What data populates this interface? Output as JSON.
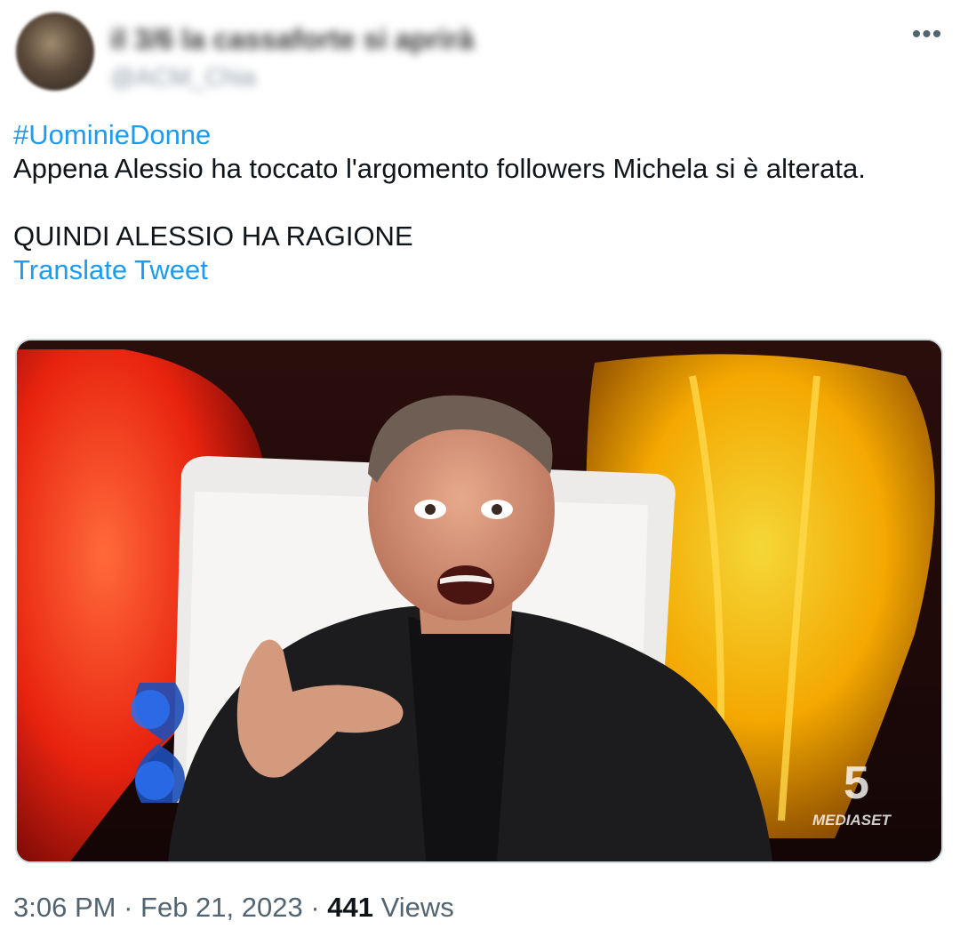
{
  "author": {
    "display_name": "il 3/6 la cassaforte si aprirà",
    "handle": "@ACM_Chia"
  },
  "tweet": {
    "hashtag": "#UominieDonne",
    "line1": "Appena Alessio ha toccato l'argomento followers Michela si è alterata.",
    "line2": "QUINDI ALESSIO HA RAGIONE",
    "translate_label": "Translate Tweet",
    "media_watermark_number": "5",
    "media_watermark_text": "MEDIASET"
  },
  "meta": {
    "time": "3:06 PM",
    "sep1": " · ",
    "date": "Feb 21, 2023",
    "sep2": " · ",
    "views_count": "441",
    "views_label": " Views"
  },
  "icons": {
    "more": "more-horizontal-icon"
  }
}
